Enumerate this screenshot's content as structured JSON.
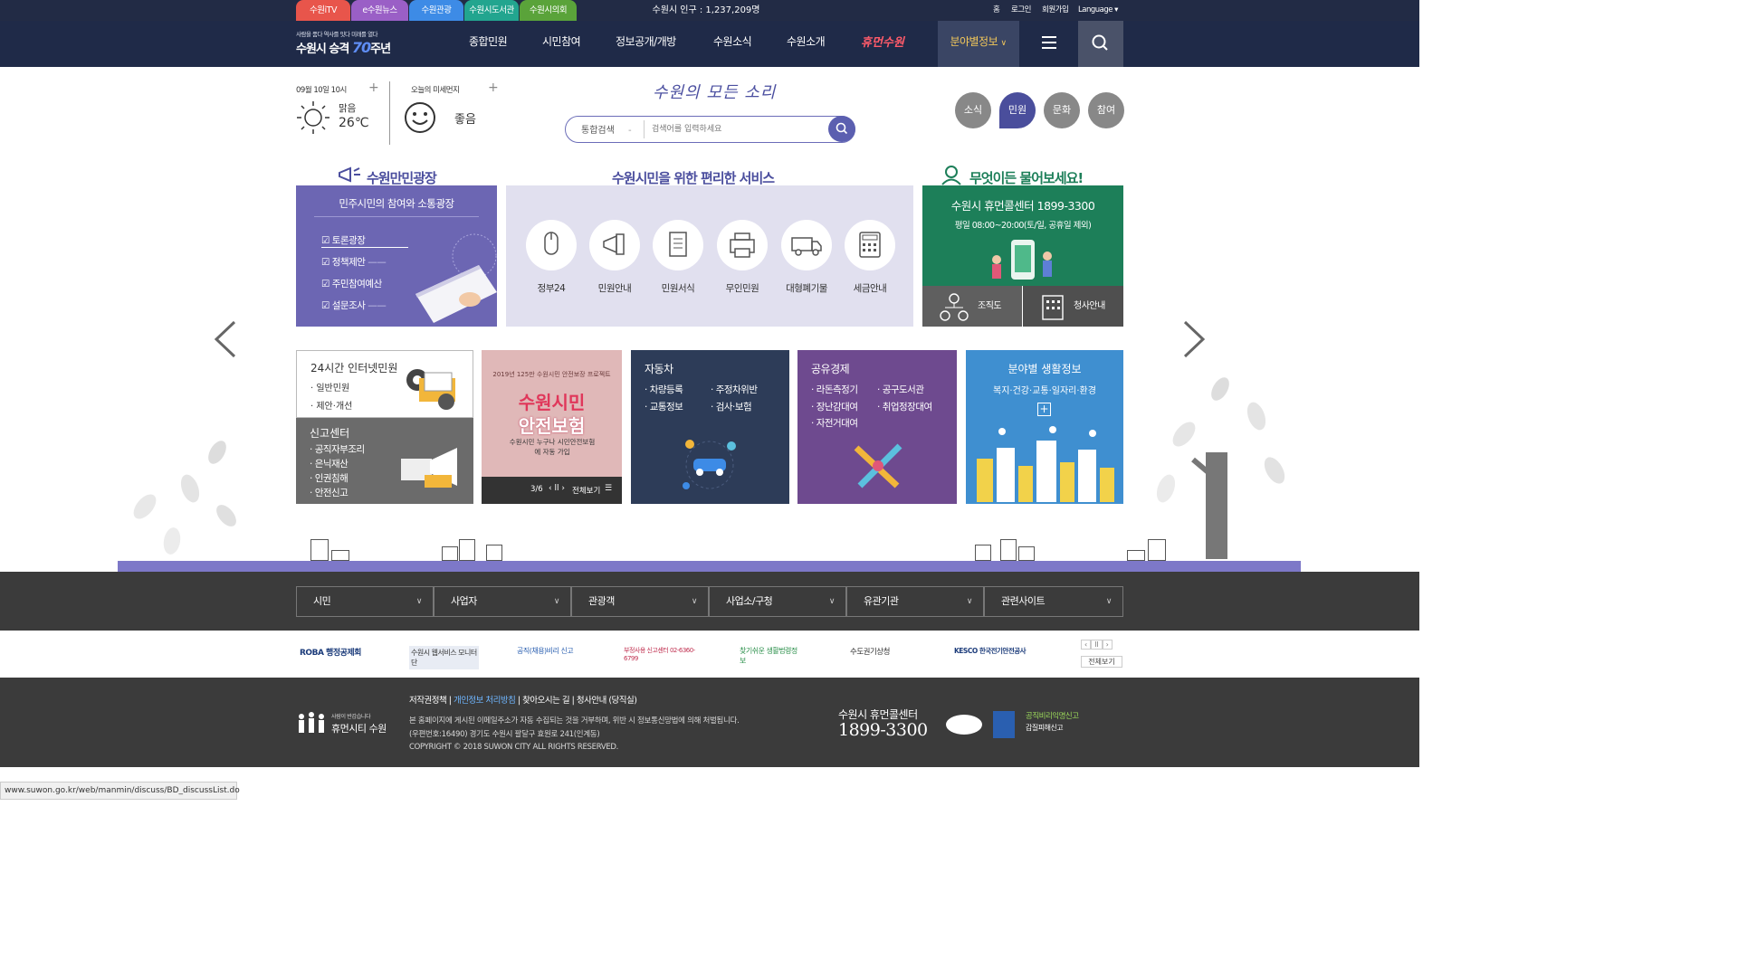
{
  "top_tabs": [
    {
      "label": "수원iTV",
      "color": "#e8554b"
    },
    {
      "label": "e수원뉴스",
      "color": "#9a5fc6"
    },
    {
      "label": "수원관광",
      "color": "#3d8be6"
    },
    {
      "label": "수원시도서관",
      "color": "#22a58f"
    },
    {
      "label": "수원시의회",
      "color": "#5aa33a"
    }
  ],
  "population": "수원시 인구 : 1,237,209명",
  "top_links": [
    "홈",
    "로그인",
    "회원가입",
    "Language"
  ],
  "logo": {
    "tagline": "사람을 품다 역사를 잇다 미래를 열다",
    "title_a": "수원시 승격",
    "title_num": "70",
    "title_b": "주년"
  },
  "main_menu": [
    "종합민원",
    "시민참여",
    "정보공개/개방",
    "수원소식",
    "수원소개"
  ],
  "brand": "휴먼수원",
  "field_info": "분야별정보",
  "weather": {
    "date": "09월 10일 10시",
    "condition": "맑음",
    "temp": "26℃"
  },
  "dust": {
    "label": "오늘의 미세먼지",
    "value": "좋음"
  },
  "slogan": "수원의 모든 소리",
  "search": {
    "select": "통합검색",
    "placeholder": "검색어를 입력하세요"
  },
  "quick_tabs": [
    "소식",
    "민원",
    "문화",
    "참여"
  ],
  "headings": {
    "plaza": "수원만민광장",
    "services": "수원시민을 위한 편리한 서비스",
    "ask": "무엇이든 물어보세요!"
  },
  "plaza": {
    "title": "민주시민의 참여와 소통광장",
    "items": [
      "토론광장",
      "정책제안",
      "주민참여예산",
      "설문조사"
    ]
  },
  "services": [
    "정부24",
    "민원안내",
    "민원서식",
    "무인민원",
    "대형폐기물",
    "세금안내"
  ],
  "callcenter": {
    "title": "수원시 휴먼콜센터 1899-3300",
    "hours": "평일 08:00~20:00(토/일, 공휴일 제외)",
    "btn_org": "조직도",
    "btn_office": "청사안내"
  },
  "tile_internet": {
    "title": "24시간 인터넷민원",
    "items": [
      "일반민원",
      "제안·개선"
    ]
  },
  "tile_report": {
    "title": "신고센터",
    "items": [
      "공직자부조리",
      "은닉재산",
      "인권침해",
      "안전신고"
    ]
  },
  "tile_insurance": {
    "top": "2019년 125만 수원시민 안전보장 프로젝트",
    "title_a": "수원시민",
    "title_b": "안전보험",
    "sub": "수원시민 누구나 시민안전보험에 자동 가입",
    "pager": "3/6",
    "view_all": "전체보기"
  },
  "tile_car": {
    "title": "자동차",
    "items": [
      "차량등록",
      "주정차위반",
      "교통정보",
      "검사·보험"
    ]
  },
  "tile_share": {
    "title": "공유경제",
    "items": [
      "라돈측정기",
      "공구도서관",
      "장난감대여",
      "취업정장대여",
      "자전거대여"
    ]
  },
  "tile_life": {
    "title": "분야별 생활정보",
    "sub": "복지·건강·교통·일자리·환경"
  },
  "footer_selects": [
    "시민",
    "사업자",
    "관광객",
    "사업소/구청",
    "유관기관",
    "관련사이트"
  ],
  "banners": [
    "ROBA 행정공제회",
    "수원시 웹서비스 모니터단",
    "공직(채용)비리 신고",
    "부정사용 신고센터 02-6360-6799",
    "찾기쉬운 생활법령정보",
    "수도권기상청",
    "KESCO 한국전기안전공사"
  ],
  "banner_view_all": "전체보기",
  "footer": {
    "links": [
      "저작권정책",
      "개인정보 처리방침",
      "찾아오시는 길",
      "청사안내 (당직실)"
    ],
    "notice": "본 홈페이지에 게시된 이메일주소가 자동 수집되는 것을 거부하며, 위반 시 정보통신망법에 의해 처벌됩니다.",
    "address": "(우편번호:16490) 경기도 수원시 팔달구 효원로 241(인계동)",
    "copyright": "COPYRIGHT © 2018 SUWON CITY ALL RIGHTS RESERVED.",
    "logo_tag": "사람이 반갑습니다",
    "logo": "휴먼시티 수원",
    "call_title": "수원시 휴먼콜센터",
    "call_number": "1899-3300",
    "badge1": "공직비리익명신고",
    "badge2": "갑질피해신고"
  },
  "status_url": "www.suwon.go.kr/web/manmin/discuss/BD_discussList.do",
  "colors": {
    "navy": "#1f2a48",
    "purple": "#6c66b3",
    "green": "#1d7f59",
    "accent": "#f3c85a"
  }
}
